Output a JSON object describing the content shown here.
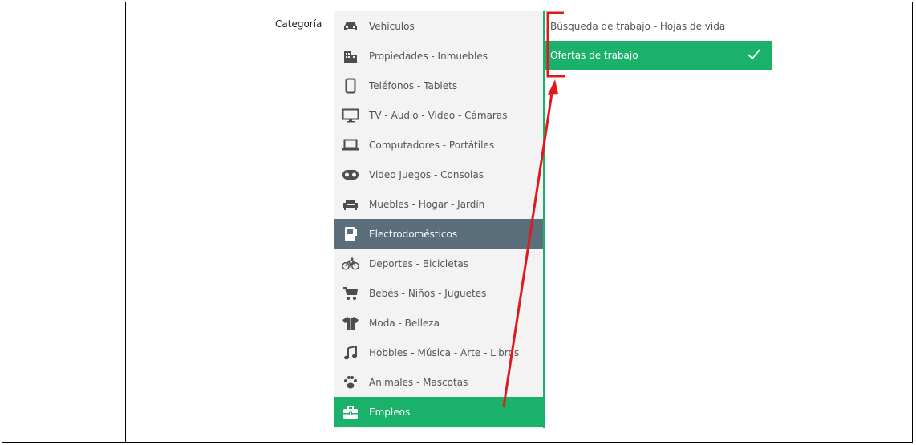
{
  "form": {
    "category_label": "Categoría"
  },
  "menu": {
    "items": [
      {
        "label": "Vehículos",
        "icon": "car-icon"
      },
      {
        "label": "Propiedades - Inmuebles",
        "icon": "building-icon"
      },
      {
        "label": "Teléfonos - Tablets",
        "icon": "phone-icon"
      },
      {
        "label": "TV - Audio - Video - Cámaras",
        "icon": "monitor-icon"
      },
      {
        "label": "Computadores - Portátiles",
        "icon": "laptop-icon"
      },
      {
        "label": "Video Juegos - Consolas",
        "icon": "gamepad-icon"
      },
      {
        "label": "Muebles - Hogar - Jardín",
        "icon": "sofa-icon"
      },
      {
        "label": "Electrodomésticos",
        "icon": "appliance-icon"
      },
      {
        "label": "Deportes - Bicicletas",
        "icon": "bicycle-icon"
      },
      {
        "label": "Bebés - Niños - Juguetes",
        "icon": "stroller-icon"
      },
      {
        "label": "Moda - Belleza",
        "icon": "shirt-icon"
      },
      {
        "label": "Hobbies - Música - Arte - Libros",
        "icon": "music-icon"
      },
      {
        "label": "Animales - Mascotas",
        "icon": "paw-icon"
      },
      {
        "label": "Empleos",
        "icon": "briefcase-icon"
      }
    ]
  },
  "submenu": {
    "items": [
      {
        "label": "Búsqueda de trabajo - Hojas de vida"
      },
      {
        "label": "Ofertas de trabajo"
      }
    ]
  },
  "colors": {
    "accent": "#1ab26b",
    "hover": "#5a6f7b",
    "annotation": "#e0191f"
  }
}
